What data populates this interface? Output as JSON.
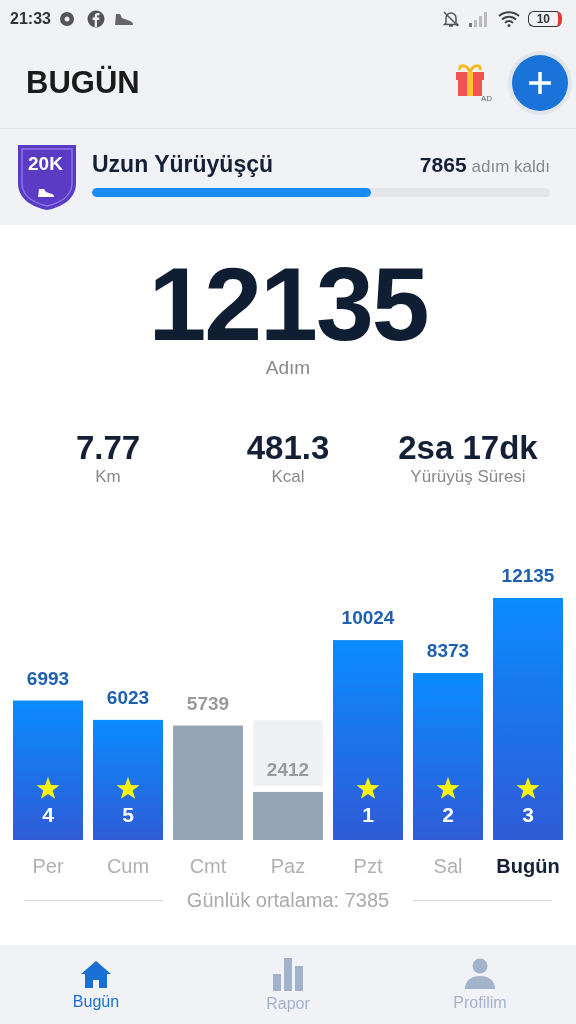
{
  "status_bar": {
    "time": "21:33",
    "battery": "10"
  },
  "header": {
    "title": "BUGÜN",
    "ad_label": "AD"
  },
  "goal": {
    "badge": "20K",
    "name": "Uzun Yürüyüşçü",
    "remaining": "7865",
    "remaining_label": "adım kaldı",
    "level": 0.61
  },
  "steps": {
    "value": "12135",
    "label": "Adım"
  },
  "stats": [
    {
      "value": "7.77",
      "label": "Km"
    },
    {
      "value": "481.3",
      "label": "Kcal"
    },
    {
      "value": "2sa 17dk",
      "label": "Yürüyüş Süresi"
    }
  ],
  "chart_data": {
    "type": "bar",
    "categories": [
      "Per",
      "Cum",
      "Cmt",
      "Paz",
      "Pzt",
      "Sal",
      "Bugün"
    ],
    "values": [
      6993,
      6023,
      5739,
      2412,
      10024,
      8373,
      12135
    ],
    "ylim": [
      0,
      12135
    ],
    "data_labels": true
  },
  "bars": [
    {
      "goal_met": true,
      "rank": "4",
      "selected": false
    },
    {
      "goal_met": true,
      "rank": "5",
      "selected": false
    },
    {
      "goal_met": false,
      "selected": false
    },
    {
      "goal_met": false,
      "selected": false
    },
    {
      "goal_met": true,
      "rank": "1",
      "selected": false
    },
    {
      "goal_met": true,
      "rank": "2",
      "selected": false
    },
    {
      "goal_met": true,
      "rank": "3",
      "selected": true
    }
  ],
  "average": "Günlük ortalama: 7385",
  "nav": [
    {
      "label": "Bugün",
      "selected": true
    },
    {
      "label": "Rapor",
      "selected": false
    },
    {
      "label": "Profilim",
      "selected": false
    }
  ]
}
